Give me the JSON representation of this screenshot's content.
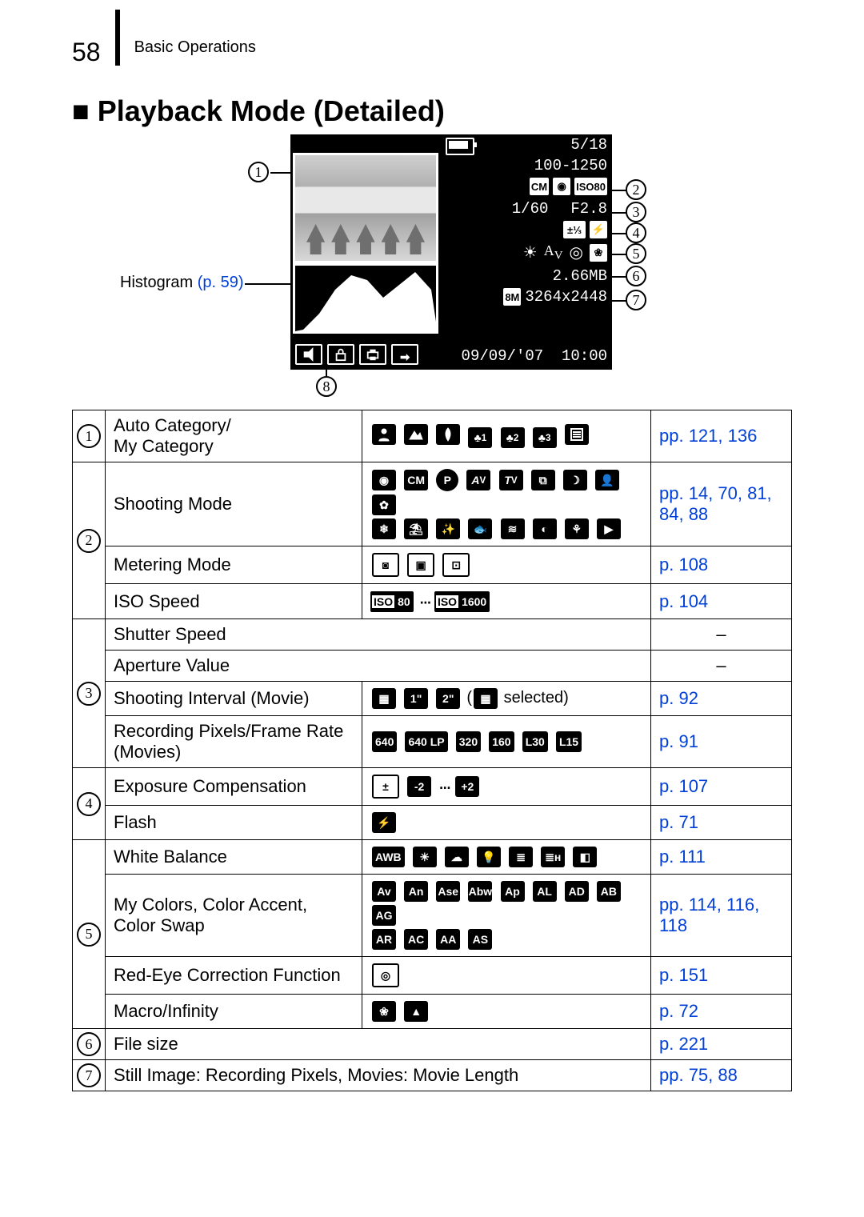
{
  "page": {
    "number": "58",
    "section": "Basic Operations",
    "title": "Playback Mode (Detailed)"
  },
  "histogram_label": "Histogram",
  "histogram_ref": "(p. 59)",
  "screen": {
    "counter": "5/18",
    "folder_file": "100-1250",
    "mode_row_iso": "ISO80",
    "shutter": "1/60",
    "aperture": "F2.8",
    "ev_icon": "±⅓",
    "filesize": "2.66MB",
    "res_icon": "8M",
    "resolution": "3264x2448",
    "date": "09/09/'07",
    "time": "10:00"
  },
  "callouts": {
    "c1": "1",
    "c2": "2",
    "c3": "3",
    "c4": "4",
    "c5": "5",
    "c6": "6",
    "c7": "7",
    "c8": "8"
  },
  "rows": [
    {
      "num": "1",
      "desc": "Auto Category/\nMy Category",
      "pages": "pp. 121, 136"
    },
    {
      "num": "2",
      "desc": "Shooting Mode",
      "pages": "pp. 14, 70, 81, 84, 88"
    },
    {
      "num": "2b",
      "desc": "Metering Mode",
      "pages": "p. 108"
    },
    {
      "num": "2c",
      "desc": "ISO Speed",
      "pages": "p. 104"
    },
    {
      "num": "3",
      "desc": "Shutter Speed",
      "pages": "–"
    },
    {
      "num": "3b",
      "desc": "Aperture Value",
      "pages": "–"
    },
    {
      "num": "3c",
      "desc": "Shooting Interval (Movie)",
      "pages": "p. 92",
      "extra": "selected"
    },
    {
      "num": "3d",
      "desc": "Recording Pixels/Frame Rate (Movies)",
      "pages": "p. 91"
    },
    {
      "num": "4",
      "desc": "Exposure Compensation",
      "pages": "p. 107"
    },
    {
      "num": "4b",
      "desc": "Flash",
      "pages": "p. 71"
    },
    {
      "num": "5",
      "desc": "White Balance",
      "pages": "p. 111"
    },
    {
      "num": "5b",
      "desc": "My Colors, Color Accent, Color Swap",
      "pages": "pp. 114, 116, 118"
    },
    {
      "num": "5c",
      "desc": "Red-Eye Correction Function",
      "pages": "p. 151"
    },
    {
      "num": "5d",
      "desc": "Macro/Infinity",
      "pages": "p. 72"
    },
    {
      "num": "6",
      "desc": "File size",
      "pages": "p. 221"
    },
    {
      "num": "7",
      "desc": "Still Image: Recording Pixels, Movies: Movie Length",
      "pages": "pp. 75, 88"
    }
  ],
  "icons": {
    "ev_minus": "-2",
    "ev_plus": "+2",
    "iso_lo": "80",
    "iso_hi": "1600",
    "iso_lbl": "ISO",
    "interval_1": "1\"",
    "interval_2": "2\"",
    "rec_640": "640",
    "rec_640lp": "640 LP",
    "rec_320": "320",
    "rec_160": "160",
    "rec_l30": "L30",
    "rec_l15": "L15",
    "wb_awb": "AWB",
    "mc": [
      "Av",
      "An",
      "Ase",
      "Abw",
      "Ap",
      "AL",
      "AD",
      "AB",
      "AG",
      "AR",
      "AC",
      "AA",
      "AS"
    ],
    "cat": [
      "1",
      "2",
      "3"
    ]
  }
}
